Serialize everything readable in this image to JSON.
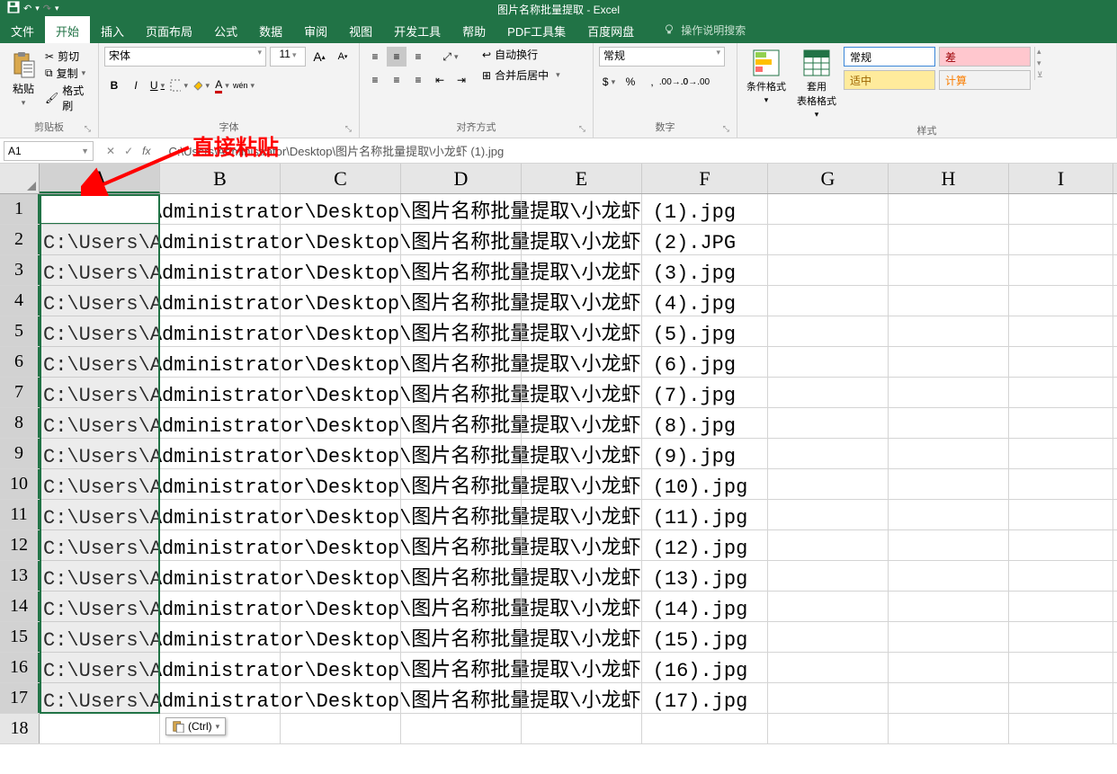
{
  "title": "图片名称批量提取 - Excel",
  "qat": {
    "save": "save",
    "undo": "undo",
    "redo": "redo"
  },
  "tabs": [
    "文件",
    "开始",
    "插入",
    "页面布局",
    "公式",
    "数据",
    "审阅",
    "视图",
    "开发工具",
    "帮助",
    "PDF工具集",
    "百度网盘"
  ],
  "active_tab": 1,
  "tell_me": "操作说明搜索",
  "ribbon": {
    "clipboard": {
      "paste": "粘贴",
      "cut": "剪切",
      "copy": "复制",
      "format_painter": "格式刷",
      "label": "剪贴板"
    },
    "font": {
      "name": "宋体",
      "size": "11",
      "label": "字体",
      "bold": "B",
      "italic": "I",
      "underline": "U",
      "pinyin": "wén",
      "increase": "A",
      "decrease": "A"
    },
    "alignment": {
      "wrap": "自动换行",
      "merge": "合并后居中",
      "label": "对齐方式"
    },
    "number": {
      "format": "常规",
      "label": "数字"
    },
    "styles": {
      "cond": "条件格式",
      "table": "套用\n表格格式",
      "label": "样式",
      "normal": "常规",
      "bad": "差",
      "good": "适中",
      "calc": "计算"
    }
  },
  "namebox": "A1",
  "formula": "C:\\Users\\Administrator\\Desktop\\图片名称批量提取\\小龙虾 (1).jpg",
  "annotation": "直接粘贴",
  "columns": [
    "A",
    "B",
    "C",
    "D",
    "E",
    "F",
    "G",
    "H",
    "I"
  ],
  "cells": [
    "C:\\Users\\Administrator\\Desktop\\图片名称批量提取\\小龙虾 (1).jpg",
    "C:\\Users\\Administrator\\Desktop\\图片名称批量提取\\小龙虾 (2).JPG",
    "C:\\Users\\Administrator\\Desktop\\图片名称批量提取\\小龙虾 (3).jpg",
    "C:\\Users\\Administrator\\Desktop\\图片名称批量提取\\小龙虾 (4).jpg",
    "C:\\Users\\Administrator\\Desktop\\图片名称批量提取\\小龙虾 (5).jpg",
    "C:\\Users\\Administrator\\Desktop\\图片名称批量提取\\小龙虾 (6).jpg",
    "C:\\Users\\Administrator\\Desktop\\图片名称批量提取\\小龙虾 (7).jpg",
    "C:\\Users\\Administrator\\Desktop\\图片名称批量提取\\小龙虾 (8).jpg",
    "C:\\Users\\Administrator\\Desktop\\图片名称批量提取\\小龙虾 (9).jpg",
    "C:\\Users\\Administrator\\Desktop\\图片名称批量提取\\小龙虾 (10).jpg",
    "C:\\Users\\Administrator\\Desktop\\图片名称批量提取\\小龙虾 (11).jpg",
    "C:\\Users\\Administrator\\Desktop\\图片名称批量提取\\小龙虾 (12).jpg",
    "C:\\Users\\Administrator\\Desktop\\图片名称批量提取\\小龙虾 (13).jpg",
    "C:\\Users\\Administrator\\Desktop\\图片名称批量提取\\小龙虾 (14).jpg",
    "C:\\Users\\Administrator\\Desktop\\图片名称批量提取\\小龙虾 (15).jpg",
    "C:\\Users\\Administrator\\Desktop\\图片名称批量提取\\小龙虾 (16).jpg",
    "C:\\Users\\Administrator\\Desktop\\图片名称批量提取\\小龙虾 (17).jpg"
  ],
  "paste_options": "(Ctrl)",
  "row_count": 18
}
